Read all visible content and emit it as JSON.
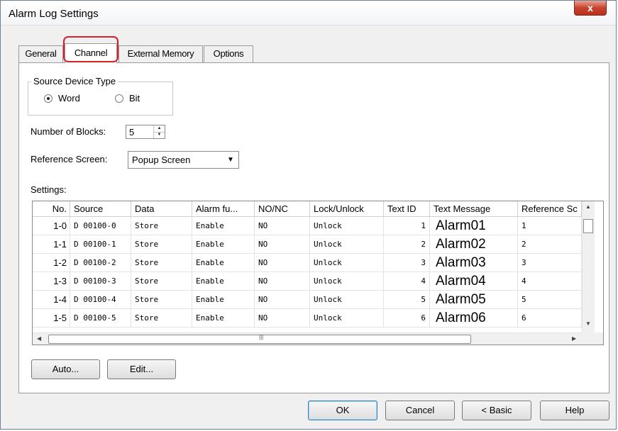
{
  "window": {
    "title": "Alarm Log Settings",
    "close_glyph": "x"
  },
  "tabs": [
    {
      "label": "General",
      "active": false
    },
    {
      "label": "Channel",
      "active": true
    },
    {
      "label": "External Memory",
      "active": false
    },
    {
      "label": "Options",
      "active": false
    }
  ],
  "source_device_type": {
    "legend": "Source Device Type",
    "options": [
      {
        "label": "Word",
        "checked": true
      },
      {
        "label": "Bit",
        "checked": false
      }
    ]
  },
  "number_of_blocks": {
    "label": "Number of Blocks:",
    "value": "5"
  },
  "reference_screen": {
    "label": "Reference Screen:",
    "value": "Popup Screen"
  },
  "settings": {
    "label": "Settings:",
    "columns": [
      "No.",
      "Source",
      "Data",
      "Alarm fu...",
      "NO/NC",
      "Lock/Unlock",
      "Text ID",
      "Text Message",
      "Reference Sc"
    ],
    "rows": [
      [
        "1-0",
        "D 00100-0",
        "Store",
        "Enable",
        "NO",
        "Unlock",
        "1",
        "Alarm01",
        "1"
      ],
      [
        "1-1",
        "D 00100-1",
        "Store",
        "Enable",
        "NO",
        "Unlock",
        "2",
        "Alarm02",
        "2"
      ],
      [
        "1-2",
        "D 00100-2",
        "Store",
        "Enable",
        "NO",
        "Unlock",
        "3",
        "Alarm03",
        "3"
      ],
      [
        "1-3",
        "D 00100-3",
        "Store",
        "Enable",
        "NO",
        "Unlock",
        "4",
        "Alarm04",
        "4"
      ],
      [
        "1-4",
        "D 00100-4",
        "Store",
        "Enable",
        "NO",
        "Unlock",
        "5",
        "Alarm05",
        "5"
      ],
      [
        "1-5",
        "D 00100-5",
        "Store",
        "Enable",
        "NO",
        "Unlock",
        "6",
        "Alarm06",
        "6"
      ]
    ]
  },
  "buttons": {
    "auto": "Auto...",
    "edit": "Edit...",
    "ok": "OK",
    "cancel": "Cancel",
    "basic": "< Basic",
    "help": "Help"
  },
  "accent_color": "#d9202a"
}
